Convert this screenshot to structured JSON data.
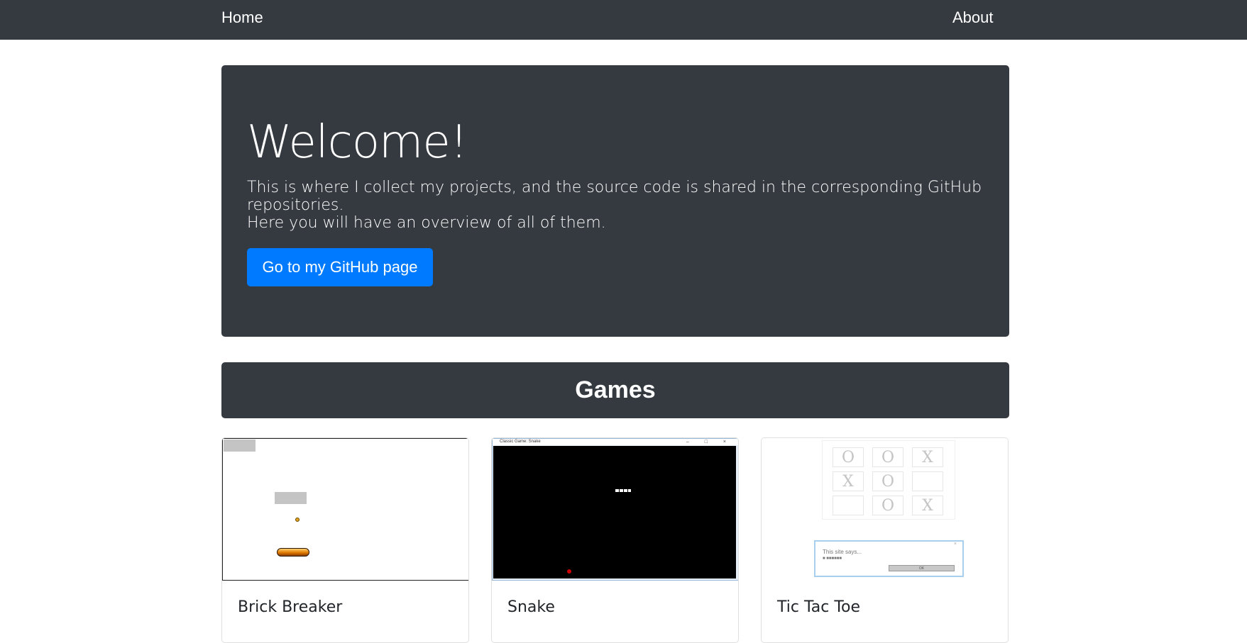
{
  "nav": {
    "home": "Home",
    "about": "About"
  },
  "jumbotron": {
    "title": "Welcome!",
    "lead1": "This is where I collect my projects, and the source code is shared in the corresponding GitHub repositories.",
    "lead2": "Here you will have an overview of all of them.",
    "button": "Go to my GitHub page"
  },
  "games_section": {
    "title": "Games",
    "cards": [
      {
        "title": "Brick Breaker"
      },
      {
        "title": "Snake",
        "window_title": "Classic Game: Snake",
        "window_controls": "– □ ×"
      },
      {
        "title": "Tic Tac Toe",
        "board": [
          "O",
          "O",
          "X",
          "X",
          "O",
          "",
          "",
          "O",
          "X"
        ],
        "dialog_title": "This site says...",
        "dialog_message": "■ ■■■■■■",
        "dialog_button": "OK",
        "dialog_close": "×"
      }
    ]
  },
  "colors": {
    "dark": "#343a40",
    "primary": "#007bff",
    "white": "#ffffff"
  }
}
